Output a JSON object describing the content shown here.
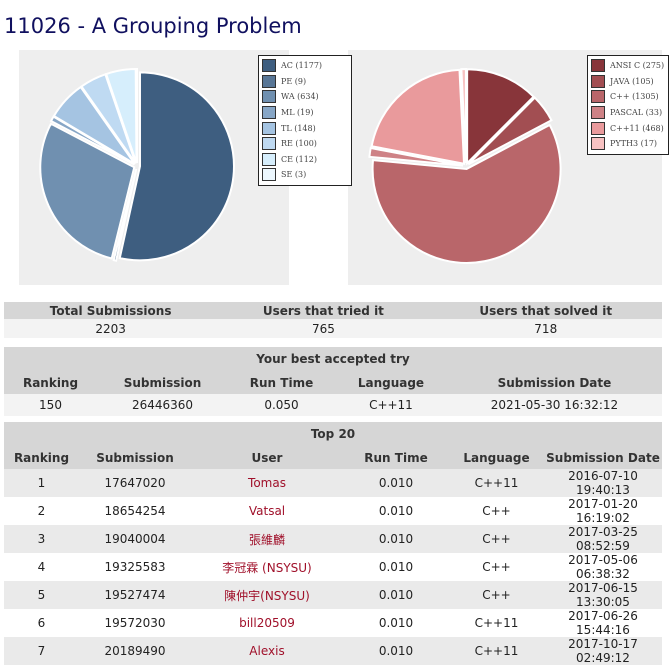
{
  "problem": {
    "title": "11026 - A Grouping Problem"
  },
  "verdict_chart": {
    "type": "pie",
    "legend": [
      {
        "label": "AC (1177)",
        "value": 1177,
        "color": "#3e5e80"
      },
      {
        "label": "PE (9)",
        "value": 9,
        "color": "#587696"
      },
      {
        "label": "WA (634)",
        "value": 634,
        "color": "#7090b0"
      },
      {
        "label": "ML (19)",
        "value": 19,
        "color": "#87a6c6"
      },
      {
        "label": "TL (148)",
        "value": 148,
        "color": "#a5c4e2"
      },
      {
        "label": "RE (100)",
        "value": 100,
        "color": "#bfdaf2"
      },
      {
        "label": "CE (112)",
        "value": 112,
        "color": "#d6eefc"
      },
      {
        "label": "SE (3)",
        "value": 3,
        "color": "#ecf7fe"
      }
    ]
  },
  "language_chart": {
    "type": "pie",
    "legend": [
      {
        "label": "ANSI C (275)",
        "value": 275,
        "color": "#88353a"
      },
      {
        "label": "JAVA (105)",
        "value": 105,
        "color": "#a24e52"
      },
      {
        "label": "C++ (1305)",
        "value": 1305,
        "color": "#b9666a"
      },
      {
        "label": "PASCAL (33)",
        "value": 33,
        "color": "#ce8286"
      },
      {
        "label": "C++11 (468)",
        "value": 468,
        "color": "#e99a9c"
      },
      {
        "label": "PYTH3 (17)",
        "value": 17,
        "color": "#f8c2c2"
      }
    ]
  },
  "stats": {
    "headers": [
      "Total Submissions",
      "Users that tried it",
      "Users that solved it"
    ],
    "values": [
      "2203",
      "765",
      "718"
    ]
  },
  "best_try": {
    "caption": "Your best accepted try",
    "headers": [
      "Ranking",
      "Submission",
      "Run Time",
      "Language",
      "Submission Date"
    ],
    "row": [
      "150",
      "26446360",
      "0.050",
      "C++11",
      "2021-05-30 16:32:12"
    ]
  },
  "top20": {
    "caption": "Top 20",
    "headers": [
      "Ranking",
      "Submission",
      "User",
      "Run Time",
      "Language",
      "Submission Date"
    ],
    "rows": [
      [
        "1",
        "17647020",
        "Tomas",
        "0.010",
        "C++11",
        "2016-07-10 19:40:13"
      ],
      [
        "2",
        "18654254",
        "Vatsal",
        "0.010",
        "C++",
        "2017-01-20 16:19:02"
      ],
      [
        "3",
        "19040004",
        "張維麟",
        "0.010",
        "C++",
        "2017-03-25 08:52:59"
      ],
      [
        "4",
        "19325583",
        "李冠霖 (NSYSU)",
        "0.010",
        "C++",
        "2017-05-06 06:38:32"
      ],
      [
        "5",
        "19527474",
        "陳仲宇(NSYSU)",
        "0.010",
        "C++",
        "2017-06-15 13:30:05"
      ],
      [
        "6",
        "19572030",
        "bill20509",
        "0.010",
        "C++11",
        "2017-06-26 15:44:16"
      ],
      [
        "7",
        "20189490",
        "Alexis",
        "0.010",
        "C++11",
        "2017-10-17 02:49:12"
      ]
    ]
  }
}
